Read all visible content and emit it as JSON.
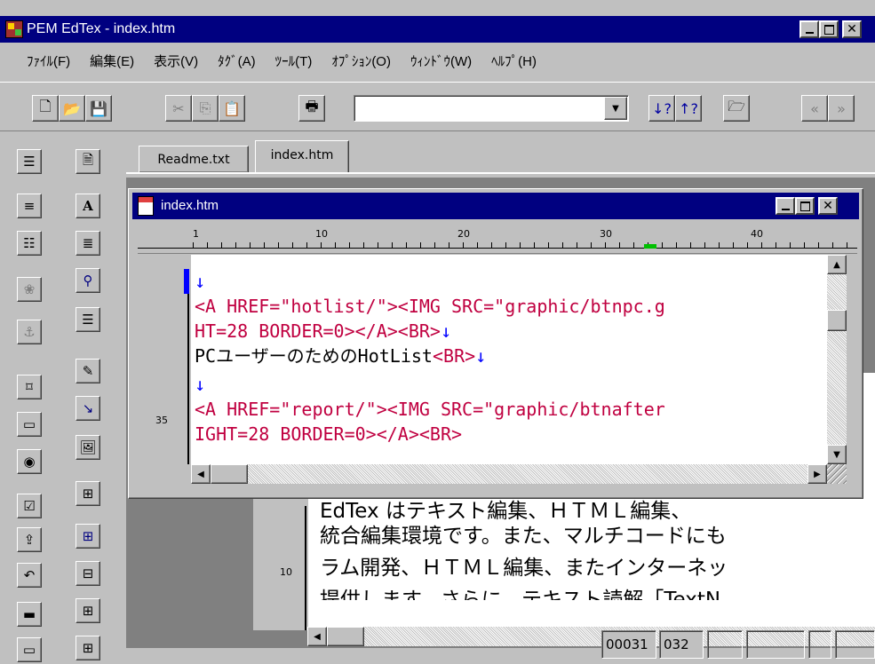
{
  "app": {
    "title": "PEM EdTex - index.htm"
  },
  "menu": [
    "ﾌｧｲﾙ(F)",
    "編集(E)",
    "表示(V)",
    "ﾀｸﾞ(A)",
    "ﾂｰﾙ(T)",
    "ｵﾌﾟｼｮﾝ(O)",
    "ｳｨﾝﾄﾞｳ(W)",
    "ﾍﾙﾌﾟ(H)"
  ],
  "tabs": [
    "Readme.txt",
    "index.htm"
  ],
  "inner_window": {
    "title": "index.htm",
    "ruler": [
      "1",
      "10",
      "20",
      "30",
      "40"
    ],
    "line_number": "35",
    "lines": [
      {
        "a": "↓",
        "b": "",
        "c": ""
      },
      {
        "a": "<A HREF=\"hotlist/\"><IMG SRC=\"graphic/btnpc.g",
        "b": "",
        "c": ""
      },
      {
        "a": "HT=28 BORDER=0></A><BR>",
        "b": "↓",
        "c": ""
      },
      {
        "a": "PCユーザーのためのHotList",
        "b": "<BR>",
        "c": "↓"
      },
      {
        "a": "↓",
        "b": "",
        "c": ""
      },
      {
        "a": "<A HREF=\"report/\"><IMG SRC=\"graphic/btnafter",
        "b": "",
        "c": ""
      },
      {
        "a": "IGHT=28 BORDER=0></A><BR>",
        "b": "",
        "c": ""
      }
    ]
  },
  "back_document": {
    "line_number": "10",
    "lines": [
      "統合編集環境です。また、マルチコードにも",
      "ラム開発、ＨＴＭＬ編集、またインターネッ",
      "提供します。さらに、テキスト読解「TextN"
    ],
    "partial_top": "EdTex はテキスト編集、ＨＴＭＬ編集、"
  },
  "status": {
    "line": "00031",
    "col": "032"
  }
}
